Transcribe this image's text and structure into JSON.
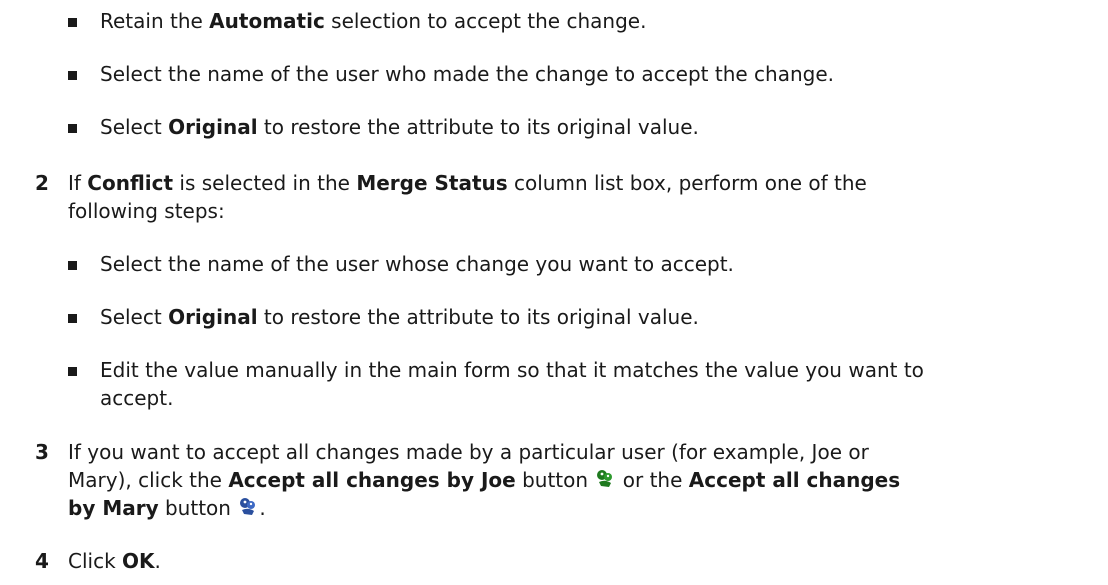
{
  "colors": {
    "text": "#1a1a1a",
    "joe_icon": "#1f7a1f",
    "mary_icon": "#2a4f9e"
  },
  "step1_bullets": [
    {
      "pre": "Retain the ",
      "bold": "Automatic",
      "post": " selection to accept the change."
    },
    {
      "pre": "Select the name of the user who made the change to accept the change.",
      "bold": "",
      "post": ""
    },
    {
      "pre": "Select ",
      "bold": "Original",
      "post": " to restore the attribute to its original value."
    }
  ],
  "step2": {
    "number": "2",
    "t1": "If ",
    "b1": "Conflict",
    "t2": " is selected in the ",
    "b2": "Merge Status",
    "t3": " column list box, perform one of the",
    "line2": "following steps:",
    "bullets": [
      {
        "pre": "Select the name of the user whose change you want to accept.",
        "bold": "",
        "post": ""
      },
      {
        "pre": "Select ",
        "bold": "Original",
        "post": " to restore the attribute to its original value."
      },
      {
        "line1": "Edit the value manually in the main form so that it matches the value you want to",
        "line2": "accept."
      }
    ]
  },
  "step3": {
    "number": "3",
    "line1": "If you want to accept all changes made by a particular user (for example, Joe or",
    "line2_pre": "Mary), click the ",
    "line2_bold1": "Accept all changes by Joe",
    "line2_mid": " button ",
    "line2_mid2": " or the ",
    "line2_bold2": "Accept all changes",
    "line3_bold": "by Mary",
    "line3_post": " button ",
    "line3_end": ".",
    "icons": [
      "accept-joe-icon",
      "accept-mary-icon"
    ]
  },
  "step4": {
    "number": "4",
    "pre": "Click ",
    "bold": "OK",
    "post": "."
  }
}
